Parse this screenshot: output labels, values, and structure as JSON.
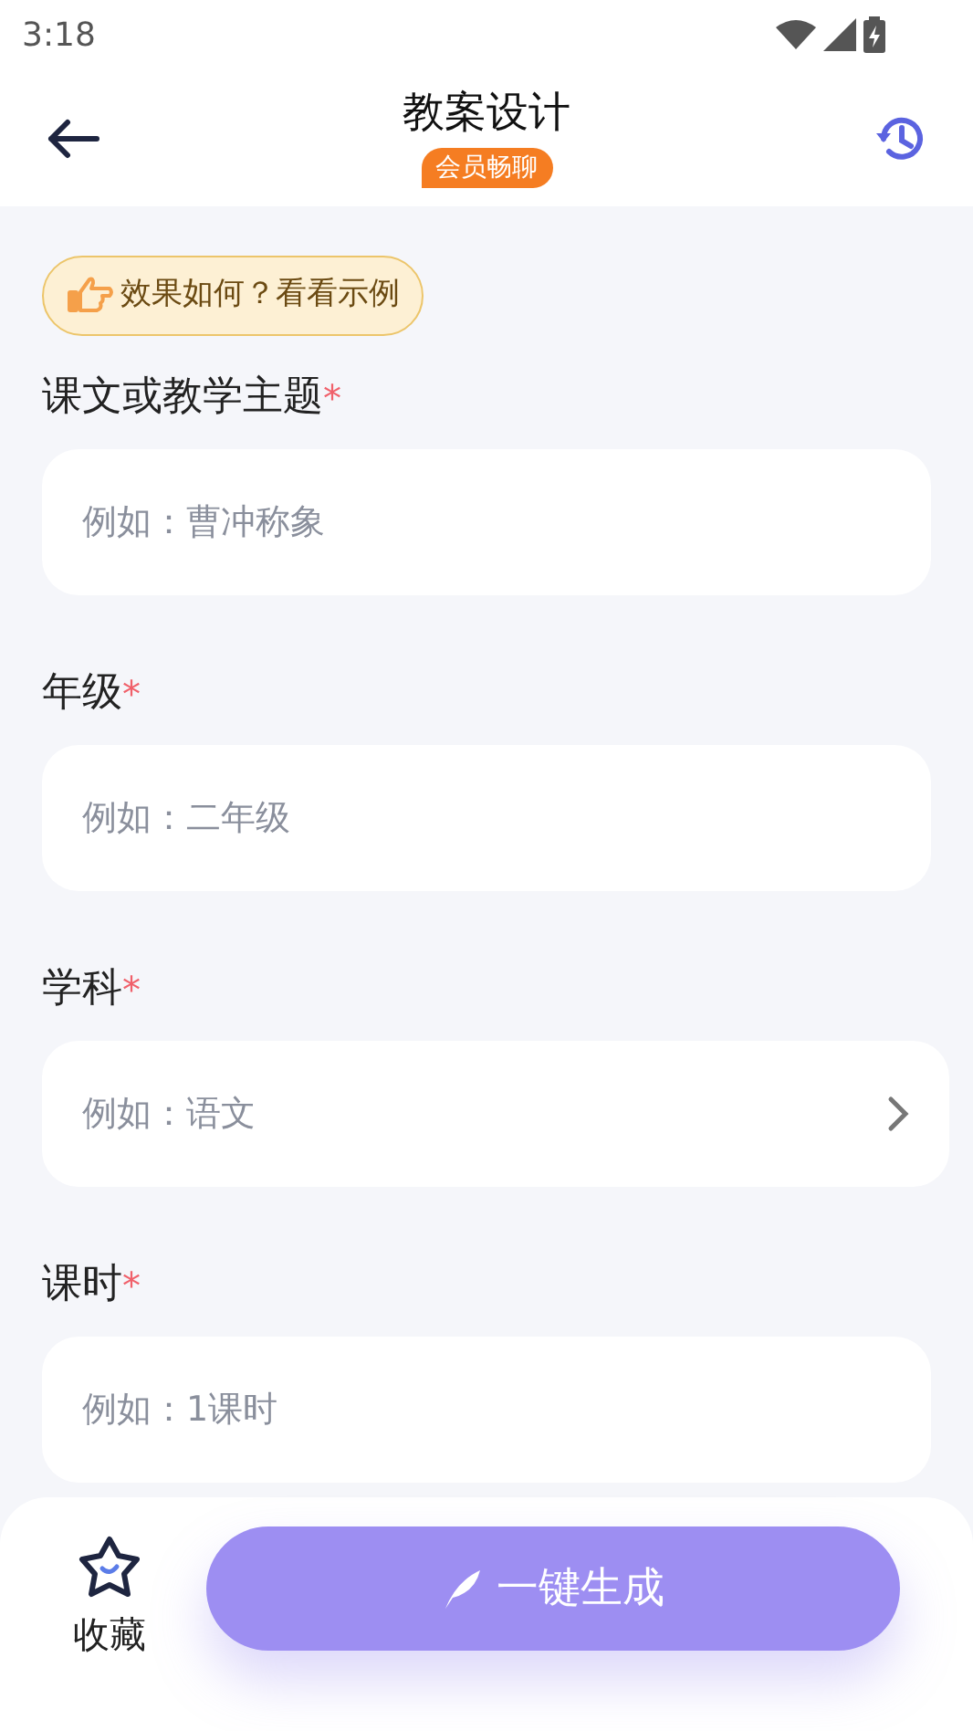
{
  "status_bar": {
    "time": "3:18"
  },
  "header": {
    "title": "教案设计",
    "badge": "会员畅聊"
  },
  "example_link": {
    "label": "效果如何？看看示例"
  },
  "fields": [
    {
      "label": "课文或教学主题",
      "mark": "*",
      "placeholder": "例如：曹冲称象",
      "kind": "text"
    },
    {
      "label": "年级",
      "mark": "*",
      "placeholder": "例如：二年级",
      "kind": "text"
    },
    {
      "label": "学科",
      "mark": "*",
      "placeholder": "例如：语文",
      "kind": "select"
    },
    {
      "label": "课时",
      "mark": "*",
      "placeholder": "例如：1课时",
      "kind": "text"
    }
  ],
  "bottom_bar": {
    "favorite": {
      "label": "收藏"
    },
    "generate_button": {
      "label": "一键生成"
    }
  }
}
